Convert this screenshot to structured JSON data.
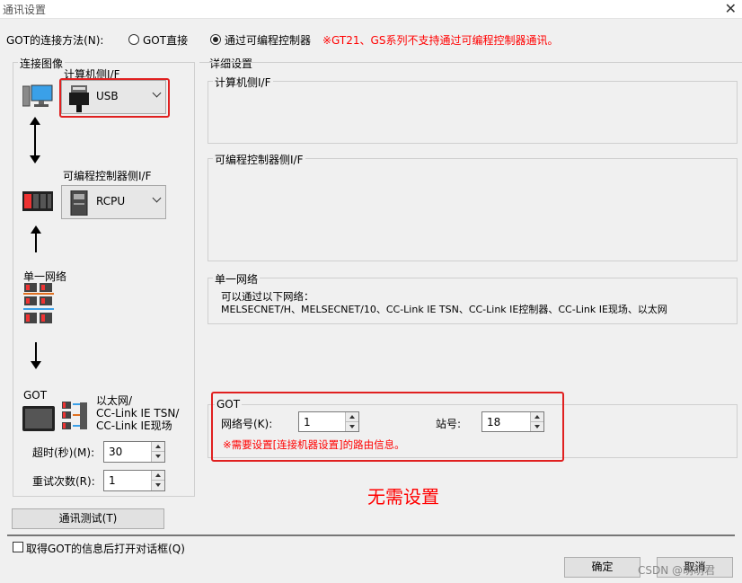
{
  "window": {
    "title": "通讯设置",
    "close_glyph": "✕"
  },
  "connection": {
    "label": "GOT的连接方法(N):",
    "option_direct": "GOT直接",
    "option_plc": "通过可编程控制器",
    "selected": "option_plc",
    "notice": "※GT21、GS系列不支持通过可编程控制器通讯。"
  },
  "image_group": {
    "title": "连接图像",
    "pc_if_label": "计算机侧I/F",
    "pc_if_value": "USB",
    "plc_if_label": "可编程控制器侧I/F",
    "plc_if_value": "RCPU",
    "network_label": "单一网络",
    "got_label": "GOT",
    "got_network_text": "以太网/\nCC-Link IE TSN/\nCC-Link IE现场"
  },
  "timeout": {
    "label": "超时(秒)(M):",
    "value": "30"
  },
  "retry": {
    "label": "重试次数(R):",
    "value": "1"
  },
  "detail": {
    "title": "详细设置",
    "pc_if_title": "计算机侧I/F",
    "plc_if_title": "可编程控制器侧I/F",
    "network_title": "单一网络",
    "network_line1": "可以通过以下网络：",
    "network_line2": "MELSECNET/H、MELSECNET/10、CC-Link IE TSN、CC-Link IE控制器、CC-Link IE现场、以太网"
  },
  "got_group": {
    "title": "GOT",
    "network_no_label": "网络号(K):",
    "network_no_value": "1",
    "station_label": "站号:",
    "station_value": "18",
    "note": "※需要设置[连接机器设置]的路由信息。"
  },
  "annotation": "无需设置",
  "buttons": {
    "test": "通讯测试(T)",
    "ok": "确定",
    "cancel": "取消"
  },
  "checkbox": {
    "label": "取得GOT的信息后打开对话框(Q)",
    "checked": false
  },
  "watermark": "CSDN @萌萌君",
  "colors": {
    "accent_red": "#ff0000",
    "highlight_box": "#e02020"
  }
}
